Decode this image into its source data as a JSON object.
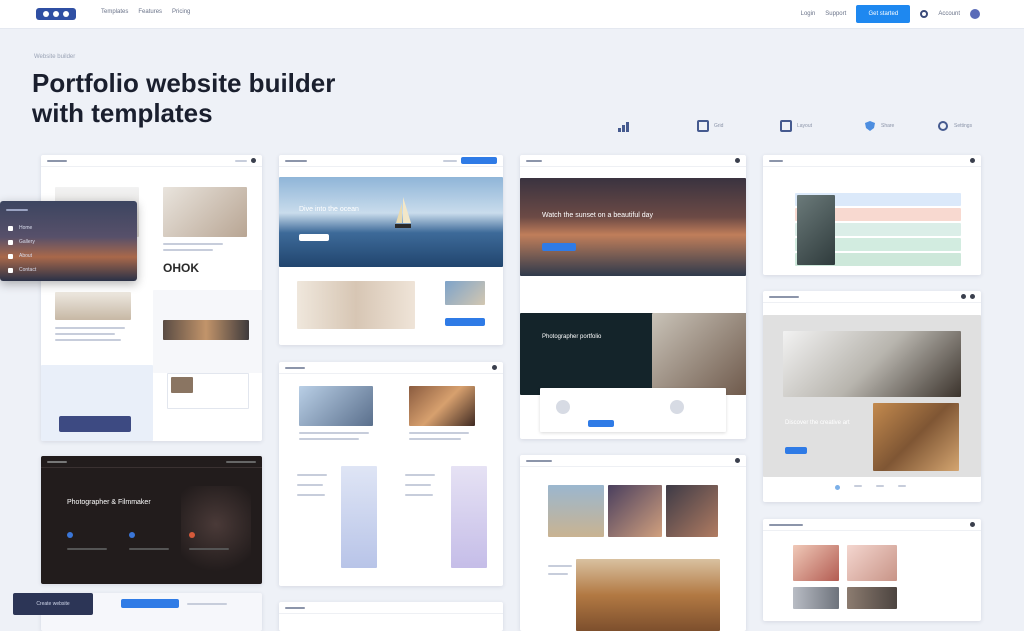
{
  "nav": {
    "links": [
      "Templates",
      "Features",
      "Pricing"
    ],
    "right_links": [
      "Login",
      "Support"
    ],
    "cta_label": "Get started",
    "user_label": "Account"
  },
  "hero": {
    "eyebrow": "Website builder",
    "title_line1": "Portfolio website builder",
    "title_line2": "with templates"
  },
  "toolbar": {
    "items": [
      "",
      "Grid",
      "Layout",
      "Share",
      "Settings"
    ]
  },
  "cards": {
    "c2_headline": "Dive into the ocean",
    "c3_headline": "Watch the sunset on a beautiful day",
    "c3_headline2": "Photographer portfolio",
    "c6_text": "Discover the creative art",
    "dark_headline": "Photographer & Filmmaker",
    "brand": "OHOK"
  },
  "float": {
    "rows": [
      "Home",
      "Gallery",
      "About",
      "Contact"
    ],
    "button_label": "Create website"
  }
}
